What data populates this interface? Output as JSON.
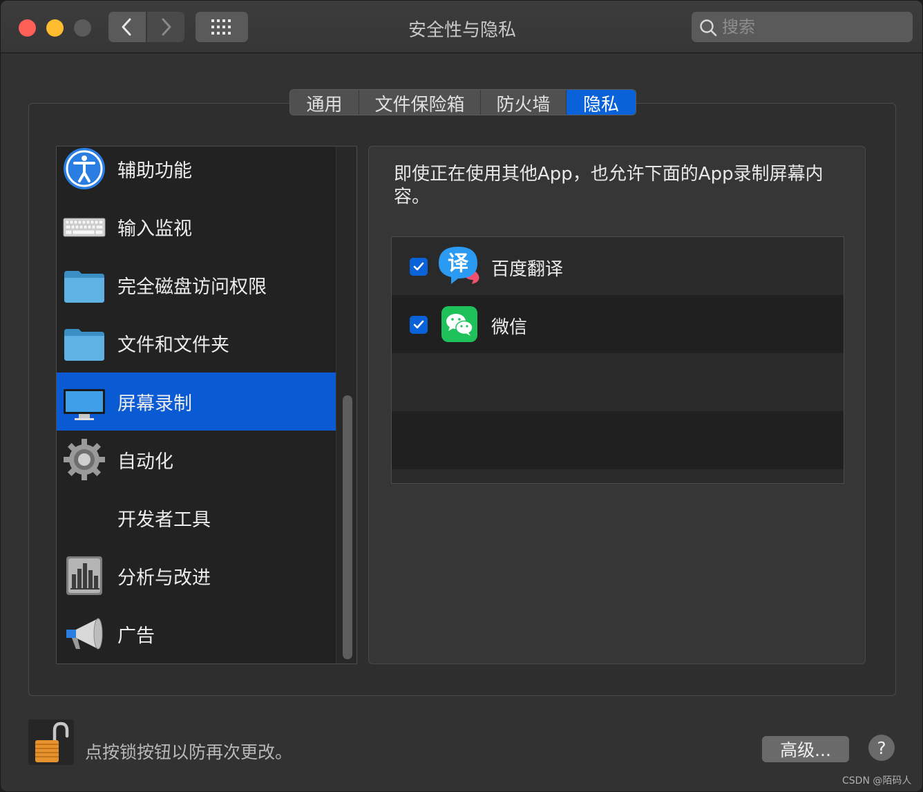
{
  "window": {
    "title": "安全性与隐私"
  },
  "search": {
    "placeholder": "搜索"
  },
  "tabs": [
    {
      "label": "通用",
      "active": false
    },
    {
      "label": "文件保险箱",
      "active": false
    },
    {
      "label": "防火墙",
      "active": false
    },
    {
      "label": "隐私",
      "active": true
    }
  ],
  "sidebar": {
    "items": [
      {
        "label": "辅助功能",
        "icon": "accessibility-icon"
      },
      {
        "label": "输入监视",
        "icon": "keyboard-icon"
      },
      {
        "label": "完全磁盘访问权限",
        "icon": "folder-icon"
      },
      {
        "label": "文件和文件夹",
        "icon": "folder-icon"
      },
      {
        "label": "屏幕录制",
        "icon": "display-icon",
        "selected": true
      },
      {
        "label": "自动化",
        "icon": "gear-icon"
      },
      {
        "label": "开发者工具",
        "icon": ""
      },
      {
        "label": "分析与改进",
        "icon": "analytics-icon"
      },
      {
        "label": "广告",
        "icon": "megaphone-icon"
      }
    ]
  },
  "panel": {
    "description": "即使正在使用其他App，也允许下面的App录制屏幕内容。",
    "apps": [
      {
        "name": "百度翻译",
        "checked": true,
        "icon": "baidu-translate-icon"
      },
      {
        "name": "微信",
        "checked": true,
        "icon": "wechat-icon"
      }
    ]
  },
  "footer": {
    "lock_text": "点按锁按钮以防再次更改。",
    "advanced_label": "高级...",
    "help_label": "?"
  },
  "watermark": "CSDN @陌码人",
  "colors": {
    "accent": "#0a62d8",
    "selection": "#0a5ad4",
    "close": "#fe5f57",
    "minimize": "#febc2e"
  }
}
